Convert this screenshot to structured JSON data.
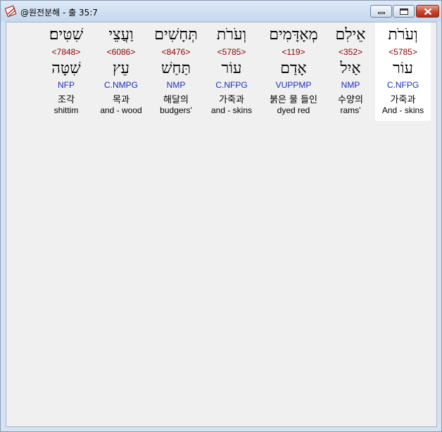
{
  "window": {
    "title": "@원전분해 - 출 35:7",
    "icon": "app-book-icon",
    "minimize_icon": "minimize-icon",
    "maximize_icon": "maximize-icon",
    "close_icon": "close-icon"
  },
  "colors": {
    "strong": "#8b0000",
    "morph": "#1c2dbf",
    "selected_bg": "#ffffff",
    "client_bg": "#f0f0f0"
  },
  "words": [
    {
      "hebrew": "וְעֹרֹת",
      "strong": "<5785>",
      "lemma": "עוֹר",
      "morph": "C.NFPG",
      "korean": "가죽과",
      "english": "And - skins",
      "selected": true
    },
    {
      "hebrew": "אֵילִם",
      "strong": "<352>",
      "lemma": "אַיִל",
      "morph": "NMP",
      "korean": "수양의",
      "english": "rams'",
      "selected": false
    },
    {
      "hebrew": "מְאָדָּמִים",
      "strong": "<119>",
      "lemma": "אָדַם",
      "morph": "VUPPMP",
      "korean": "붉은 물 들인",
      "english": "dyed red",
      "selected": false
    },
    {
      "hebrew": "וְעֹרֹת",
      "strong": "<5785>",
      "lemma": "עוֹר",
      "morph": "C.NFPG",
      "korean": "가죽과",
      "english": "and - skins",
      "selected": false
    },
    {
      "hebrew": "תְּחָשִׁים",
      "strong": "<8476>",
      "lemma": "תַּחַשׁ",
      "morph": "NMP",
      "korean": "해달의",
      "english": "budgers'",
      "selected": false
    },
    {
      "hebrew": "וַעֲצֵי",
      "strong": "<6086>",
      "lemma": "עֵץ",
      "morph": "C.NMPG",
      "korean": "목과",
      "english": "and - wood",
      "selected": false
    },
    {
      "hebrew": "שִׁטִּים׃",
      "strong": "<7848>",
      "lemma": "שִׁטָּה",
      "morph": "NFP",
      "korean": "조각",
      "english": "shittim",
      "selected": false
    }
  ]
}
